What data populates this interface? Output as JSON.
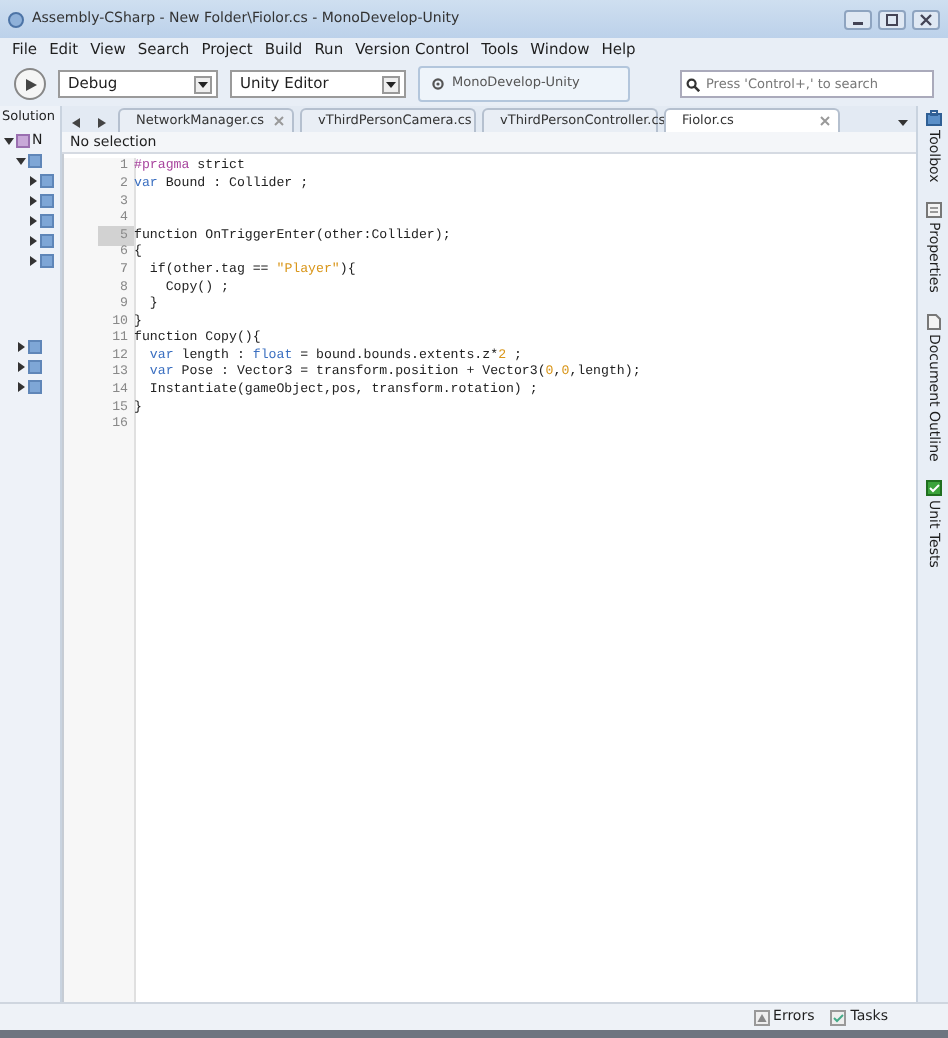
{
  "window": {
    "title": "Assembly-CSharp - New Folder\\Fiolor.cs - MonoDevelop-Unity"
  },
  "menu": [
    "File",
    "Edit",
    "View",
    "Search",
    "Project",
    "Build",
    "Run",
    "Version Control",
    "Tools",
    "Window",
    "Help"
  ],
  "toolbar": {
    "configuration": "Debug",
    "target": "Unity Editor",
    "status": "MonoDevelop-Unity",
    "search": {
      "placeholder": "Press 'Control+,' to search"
    }
  },
  "sidebar": {
    "title": "Solution",
    "tree": [
      {
        "label": "N",
        "expanded": true,
        "children": [
          {
            "expanded": true,
            "children": [
              {
                "expanded": false
              },
              {
                "expanded": false
              },
              {
                "expanded": false
              },
              {
                "expanded": false
              },
              {
                "expanded": false
              }
            ]
          },
          {
            "expanded": false
          },
          {
            "expanded": false
          },
          {
            "expanded": false
          }
        ]
      }
    ]
  },
  "tabs": [
    {
      "label": "NetworkManager.cs",
      "selected": false
    },
    {
      "label": "vThirdPersonCamera.cs",
      "selected": false
    },
    {
      "label": "vThirdPersonController.cs",
      "selected": false
    },
    {
      "label": "Fiolor.cs",
      "selected": true
    }
  ],
  "breadcrumb": "No selection",
  "code": [
    {
      "number": "1",
      "current": false,
      "tokens": [
        {
          "kind": "directive",
          "text": "#pragma"
        },
        {
          "kind": "plain",
          "text": " strict"
        }
      ]
    },
    {
      "number": "2",
      "current": false,
      "tokens": [
        {
          "kind": "keyword",
          "text": "var"
        },
        {
          "kind": "plain",
          "text": " Bound : Collider ;"
        }
      ]
    },
    {
      "number": "3",
      "current": false
    },
    {
      "number": "4",
      "current": false
    },
    {
      "number": "5",
      "current": true,
      "tokens": [
        {
          "kind": "plain",
          "text": "function OnTriggerEnter(other:Collider);"
        }
      ]
    },
    {
      "number": "6",
      "current": false,
      "tokens": [
        {
          "kind": "plain",
          "text": "{"
        }
      ]
    },
    {
      "number": "7",
      "current": false,
      "tokens": [
        {
          "kind": "plain",
          "text": "  if(other.tag == "
        },
        {
          "kind": "string",
          "text": "\"Player\""
        },
        {
          "kind": "plain",
          "text": "){"
        }
      ]
    },
    {
      "number": "8",
      "current": false,
      "tokens": [
        {
          "kind": "plain",
          "text": "    Copy() ;"
        }
      ]
    },
    {
      "number": "9",
      "current": false,
      "tokens": [
        {
          "kind": "plain",
          "text": "  }"
        }
      ]
    },
    {
      "number": "10",
      "current": false,
      "tokens": [
        {
          "kind": "plain",
          "text": "}"
        }
      ]
    },
    {
      "number": "11",
      "current": false,
      "tokens": [
        {
          "kind": "plain",
          "text": "function Copy(){"
        }
      ]
    },
    {
      "number": "12",
      "current": false,
      "tokens": [
        {
          "kind": "keyword",
          "text": "  var"
        },
        {
          "kind": "plain",
          "text": " length : "
        },
        {
          "kind": "keyword",
          "text": "float"
        },
        {
          "kind": "plain",
          "text": " = bound.bounds.extents.z*"
        },
        {
          "kind": "number",
          "text": "2"
        },
        {
          "kind": "plain",
          "text": " ;"
        }
      ]
    },
    {
      "number": "13",
      "current": false,
      "tokens": [
        {
          "kind": "keyword",
          "text": "  var"
        },
        {
          "kind": "plain",
          "text": " Pose : Vector3 = transform.position + Vector3("
        },
        {
          "kind": "number",
          "text": "0"
        },
        {
          "kind": "plain",
          "text": ","
        },
        {
          "kind": "number",
          "text": "0"
        },
        {
          "kind": "plain",
          "text": ",length);"
        }
      ]
    },
    {
      "number": "14",
      "current": false,
      "tokens": [
        {
          "kind": "plain",
          "text": "  Instantiate(gameObject,pos, transform.rotation) ;"
        }
      ]
    },
    {
      "number": "15",
      "current": false,
      "tokens": [
        {
          "kind": "plain",
          "text": "}"
        }
      ]
    },
    {
      "number": "16",
      "current": false
    }
  ],
  "right_pads": [
    {
      "label": "Toolbox",
      "kind": "toolbox"
    },
    {
      "label": "Properties",
      "kind": "properties"
    },
    {
      "label": "Document Outline",
      "kind": "outline"
    },
    {
      "label": "Unit Tests",
      "kind": "tests"
    }
  ],
  "status_bar": [
    {
      "label": "Errors",
      "kind": "errors"
    },
    {
      "label": "Tasks",
      "kind": "tasks"
    }
  ]
}
